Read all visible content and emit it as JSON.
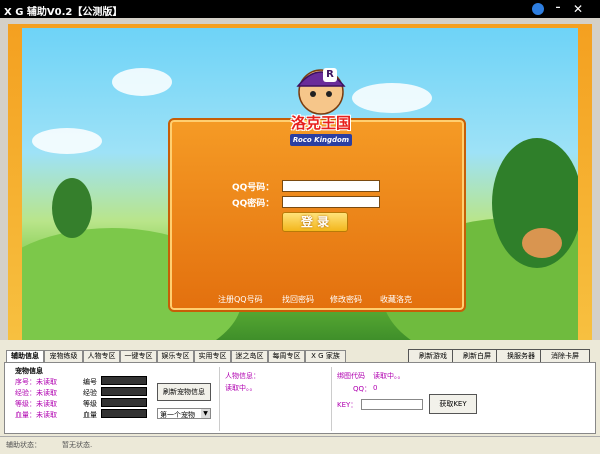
{
  "window": {
    "title": "X G 辅助V0.2【公测版】",
    "min_glyph": "–",
    "close_glyph": "✕"
  },
  "game": {
    "logo_text": "洛克王国",
    "logo_badge": "R",
    "logo_sub": "Roco Kingdom",
    "qq_label": "QQ号码：",
    "pwd_label": "QQ密码：",
    "qq_value": "",
    "pwd_value": "",
    "login_label": "登 录",
    "links": [
      "注册QQ号码",
      "找回密码",
      "修改密码",
      "收藏洛克"
    ]
  },
  "tabs": [
    "辅助信息",
    "宠物练级",
    "人物专区",
    "一键专区",
    "娱乐专区",
    "实用专区",
    "迷之岛区",
    "每周专区",
    "X G 家族"
  ],
  "right_buttons": [
    "刷新游戏",
    "刷新白屏",
    "换服务器",
    "消除卡屏"
  ],
  "pet": {
    "header": "宠物信息",
    "rows": [
      {
        "label": "序号：未读取",
        "field": "编号"
      },
      {
        "label": "经验：未读取",
        "field": "经验"
      },
      {
        "label": "等级：未读取",
        "field": "等级"
      },
      {
        "label": "血量：未读取",
        "field": "血量"
      }
    ],
    "refresh_label": "刷新宠物信息",
    "select_value": "第一个宠物"
  },
  "char": {
    "header": "人物信息：",
    "status": "读取中。。"
  },
  "right": {
    "code_label": "绑图代码",
    "code_value": "读取中。。",
    "qq_label": "QQ：",
    "qq_value": "0",
    "key_label": "KEY：",
    "key_value": "",
    "key_button": "获取KEY"
  },
  "status": {
    "label": "辅助状态：",
    "value": "暂无状态."
  }
}
